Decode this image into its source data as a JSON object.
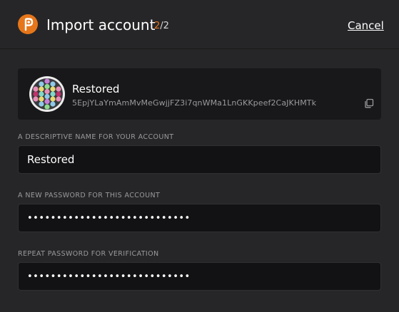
{
  "header": {
    "title": "Import account",
    "step_current": "2",
    "step_total": "/2",
    "cancel_label": "Cancel"
  },
  "account": {
    "name": "Restored",
    "address": "5EpjYLaYmAmMvMeGwjjFZ3i7qnWMa1LnGKKpeef2CaJKHMTk"
  },
  "form": {
    "name_label": "A DESCRIPTIVE NAME FOR YOUR ACCOUNT",
    "name_value": "Restored",
    "password_label": "A NEW PASSWORD FOR THIS ACCOUNT",
    "password_value": "••••••••••••••••••••••••••••",
    "repeat_label": "REPEAT PASSWORD FOR VERIFICATION",
    "repeat_value": "••••••••••••••••••••••••••••"
  },
  "colors": {
    "accent": "#e6761a",
    "background": "#262628",
    "card": "#18181a",
    "input": "#121214"
  },
  "icons": {
    "logo": "polkadot-logo-icon",
    "avatar": "identicon",
    "copy": "copy-icon"
  }
}
